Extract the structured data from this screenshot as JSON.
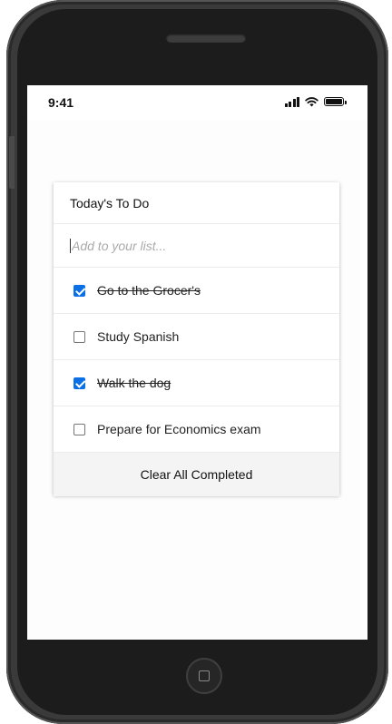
{
  "status_bar": {
    "time": "9:41",
    "signal_icon": "cellular-signal-icon",
    "wifi_icon": "wifi-icon",
    "battery_icon": "battery-icon"
  },
  "todo": {
    "title": "Today's To Do",
    "input": {
      "placeholder": "Add to your list...",
      "value": ""
    },
    "items": [
      {
        "label": "Go to the Grocer's",
        "completed": true
      },
      {
        "label": "Study Spanish",
        "completed": false
      },
      {
        "label": "Walk the dog",
        "completed": true
      },
      {
        "label": "Prepare for Economics exam",
        "completed": false
      }
    ],
    "clear_label": "Clear All Completed"
  },
  "colors": {
    "checkbox_accent": "#0b6fe6",
    "footer_bg": "#f4f4f4",
    "device_frame": "#1c1c1c"
  }
}
